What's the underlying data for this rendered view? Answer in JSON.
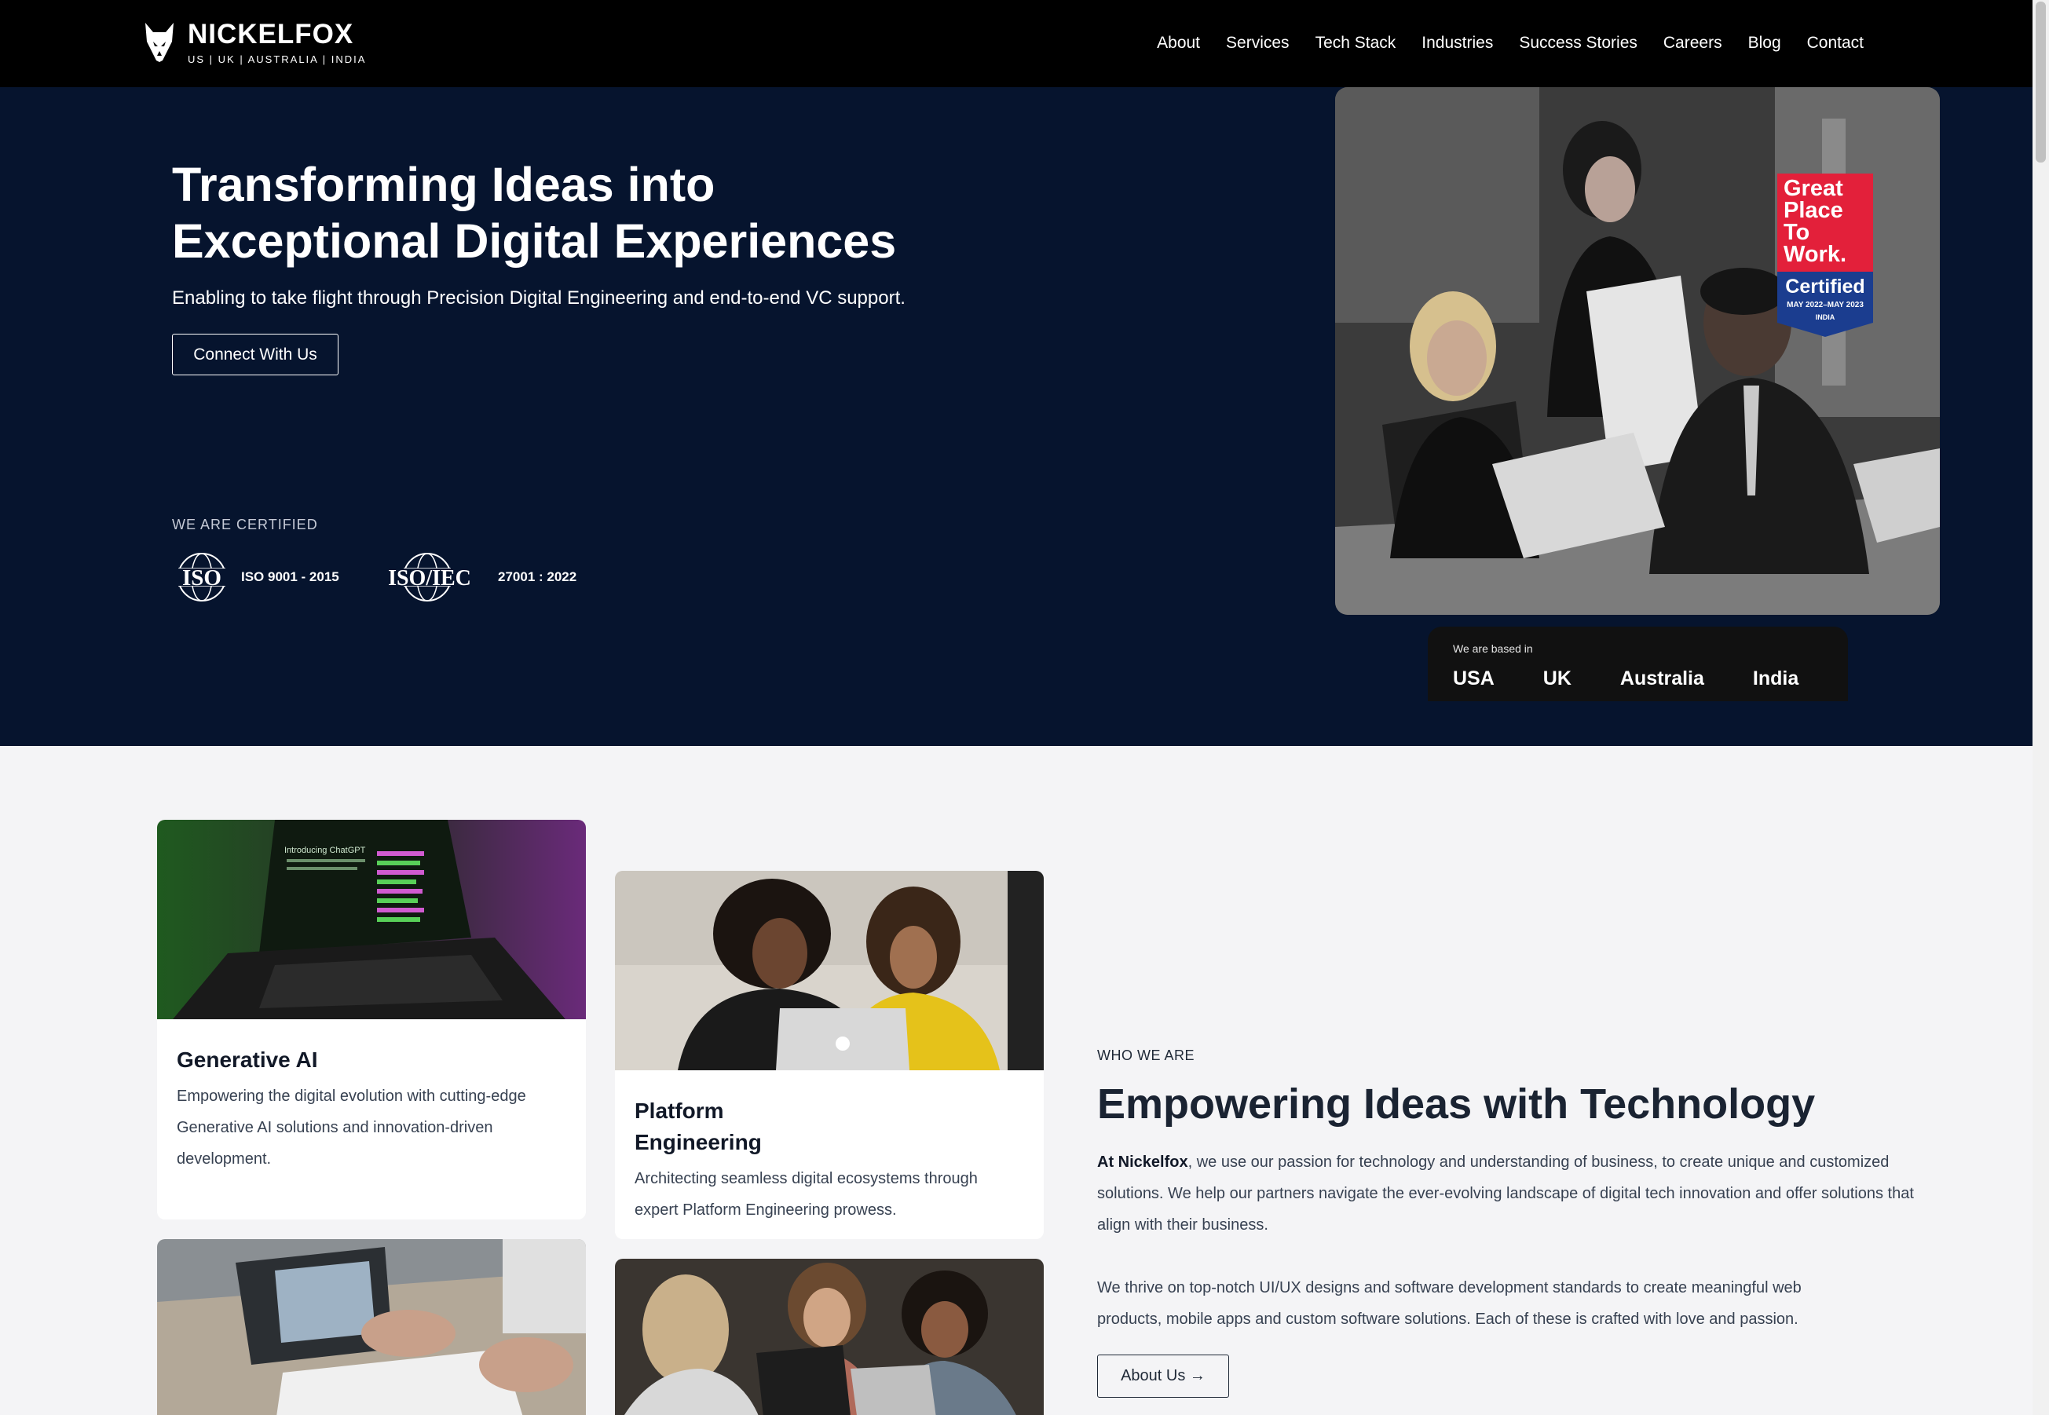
{
  "nav": {
    "logo_title": "NICKELFOX",
    "logo_sub": "US | UK | AUSTRALIA | INDIA",
    "links": [
      "About",
      "Services",
      "Tech Stack",
      "Industries",
      "Success Stories",
      "Careers",
      "Blog",
      "Contact"
    ]
  },
  "hero": {
    "title_line1": "Transforming Ideas into",
    "title_line2": "Exceptional Digital Experiences",
    "subtitle": "Enabling to take flight through Precision Digital Engineering and end-to-end VC support.",
    "cta": "Connect With Us",
    "cert_label": "WE ARE CERTIFIED",
    "certs": [
      {
        "logo": "ISO",
        "text": "ISO 9001 - 2015"
      },
      {
        "logo": "ISO/IEC",
        "text": "27001 : 2022"
      }
    ],
    "badge": {
      "line1": "Great",
      "line2": "Place",
      "line3": "To",
      "line4": "Work.",
      "certified": "Certified",
      "dates": "MAY 2022–MAY 2023",
      "country": "INDIA"
    },
    "based_label": "We are based in",
    "countries": [
      "USA",
      "UK",
      "Australia",
      "India"
    ]
  },
  "cards": [
    {
      "title": "Generative AI",
      "desc": "Empowering the digital evolution with cutting-edge Generative AI solutions and innovation-driven development.",
      "screen_text": "Introducing ChatGPT"
    },
    {
      "title": "Platform Engineering",
      "desc": "Architecting seamless digital ecosystems through expert Platform Engineering prowess."
    }
  ],
  "who": {
    "label": "WHO WE ARE",
    "title": "Empowering Ideas with Technology",
    "p1_bold": "At Nickelfox",
    "p1_rest": ", we use our passion for technology and understanding of business, to create unique and customized solutions. We help our partners navigate the ever-evolving landscape of digital tech innovation and offer solutions that align with their business.",
    "p2": "We thrive on top-notch UI/UX designs and software development standards to create meaningful web products, mobile apps and custom software solutions. Each of these is crafted with love and passion.",
    "about_btn": "About Us →"
  },
  "colors": {
    "nav_bg": "#000000",
    "hero_bg": "#06142e",
    "page_bg": "#f4f4f6",
    "gptw_red": "#e3203a",
    "gptw_blue": "#1b3d8f"
  },
  "icons": [
    "fox-logo-icon",
    "iso-globe-icon",
    "iso-iec-globe-icon",
    "great-place-to-work-badge",
    "arrow-right-icon"
  ]
}
